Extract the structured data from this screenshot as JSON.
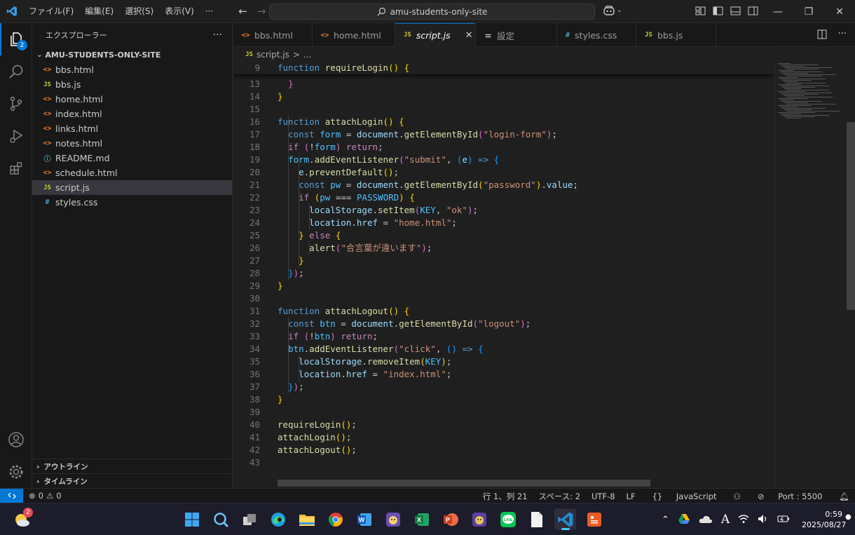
{
  "titlebar": {
    "menu": [
      "ファイル(F)",
      "編集(E)",
      "選択(S)",
      "表示(V)"
    ],
    "more": "···",
    "search_text": "amu-students-only-site"
  },
  "activity": {
    "explorer_badge": "2"
  },
  "sidebar": {
    "title": "エクスプローラー",
    "more": "···",
    "folder": "AMU-STUDENTS-ONLY-SITE",
    "files": [
      {
        "name": "bbs.html",
        "type": "html"
      },
      {
        "name": "bbs.js",
        "type": "js"
      },
      {
        "name": "home.html",
        "type": "html"
      },
      {
        "name": "index.html",
        "type": "html"
      },
      {
        "name": "links.html",
        "type": "html"
      },
      {
        "name": "notes.html",
        "type": "html"
      },
      {
        "name": "README.md",
        "type": "md"
      },
      {
        "name": "schedule.html",
        "type": "html"
      },
      {
        "name": "script.js",
        "type": "js",
        "selected": true
      },
      {
        "name": "styles.css",
        "type": "css"
      }
    ],
    "outline": "アウトライン",
    "timeline": "タイムライン"
  },
  "tabs": [
    {
      "label": "bbs.html",
      "type": "html",
      "state": "normal"
    },
    {
      "label": "home.html",
      "type": "html",
      "state": "dirty"
    },
    {
      "label": "script.js",
      "type": "js",
      "state": "active"
    },
    {
      "label": "設定",
      "type": "settings",
      "state": "normal"
    },
    {
      "label": "styles.css",
      "type": "css",
      "state": "dirty"
    },
    {
      "label": "bbs.js",
      "type": "js",
      "state": "normal"
    }
  ],
  "breadcrumb": {
    "file": "script.js",
    "sep": ">",
    "rest": "..."
  },
  "editor": {
    "sticky_line": {
      "n": "9",
      "html": "<span class='k'>function</span> <span class='f'>requireLogin</span><span class='b1'>()</span> <span class='b1'>{</span>"
    },
    "lines": [
      {
        "n": "13",
        "html": "  <span class='b2'>}</span>"
      },
      {
        "n": "14",
        "html": "<span class='b1'>}</span>"
      },
      {
        "n": "15",
        "html": ""
      },
      {
        "n": "16",
        "html": "<span class='k'>function</span> <span class='f'>attachLogin</span><span class='b1'>()</span> <span class='b1'>{</span>"
      },
      {
        "n": "17",
        "html": "  <span class='k'>const</span> <span class='c'>form</span> = <span class='v'>document</span>.<span class='f'>getElementById</span><span class='b2'>(</span><span class='s'>\"login-form\"</span><span class='b2'>)</span>;"
      },
      {
        "n": "18",
        "html": "  <span class='kc'>if</span> <span class='b2'>(</span>!<span class='c'>form</span><span class='b2'>)</span> <span class='kc'>return</span>;"
      },
      {
        "n": "19",
        "html": "  <span class='c'>form</span>.<span class='f'>addEventListener</span><span class='b2'>(</span><span class='s'>\"submit\"</span>, <span class='b3'>(</span><span class='v'>e</span><span class='b3'>)</span> <span class='k'>=&gt;</span> <span class='b3'>{</span>"
      },
      {
        "n": "20",
        "html": "    <span class='v'>e</span>.<span class='f'>preventDefault</span><span class='b1'>()</span>;"
      },
      {
        "n": "21",
        "html": "    <span class='k'>const</span> <span class='c'>pw</span> = <span class='v'>document</span>.<span class='f'>getElementById</span><span class='b1'>(</span><span class='s'>\"password\"</span><span class='b1'>)</span>.<span class='v'>value</span>;"
      },
      {
        "n": "22",
        "html": "    <span class='kc'>if</span> <span class='b1'>(</span><span class='c'>pw</span> === <span class='c'>PASSWORD</span><span class='b1'>)</span> <span class='b1'>{</span>"
      },
      {
        "n": "23",
        "html": "      <span class='v'>localStorage</span>.<span class='f'>setItem</span><span class='b2'>(</span><span class='c'>KEY</span>, <span class='s'>\"ok\"</span><span class='b2'>)</span>;"
      },
      {
        "n": "24",
        "html": "      <span class='v'>location</span>.<span class='v'>href</span> = <span class='s'>\"home.html\"</span>;"
      },
      {
        "n": "25",
        "html": "    <span class='b1'>}</span> <span class='kc'>else</span> <span class='b1'>{</span>"
      },
      {
        "n": "26",
        "html": "      <span class='f'>alert</span><span class='b2'>(</span><span class='s'>\"合言葉が違います\"</span><span class='b2'>)</span>;"
      },
      {
        "n": "27",
        "html": "    <span class='b1'>}</span>"
      },
      {
        "n": "28",
        "html": "  <span class='b3'>}</span><span class='b2'>)</span>;"
      },
      {
        "n": "29",
        "html": "<span class='b1'>}</span>"
      },
      {
        "n": "30",
        "html": ""
      },
      {
        "n": "31",
        "html": "<span class='k'>function</span> <span class='f'>attachLogout</span><span class='b1'>()</span> <span class='b1'>{</span>"
      },
      {
        "n": "32",
        "html": "  <span class='k'>const</span> <span class='c'>btn</span> = <span class='v'>document</span>.<span class='f'>getElementById</span><span class='b2'>(</span><span class='s'>\"logout\"</span><span class='b2'>)</span>;"
      },
      {
        "n": "33",
        "html": "  <span class='kc'>if</span> <span class='b2'>(</span>!<span class='c'>btn</span><span class='b2'>)</span> <span class='kc'>return</span>;"
      },
      {
        "n": "34",
        "html": "  <span class='c'>btn</span>.<span class='f'>addEventListener</span><span class='b2'>(</span><span class='s'>\"click\"</span>, <span class='b3'>()</span> <span class='k'>=&gt;</span> <span class='b3'>{</span>"
      },
      {
        "n": "35",
        "html": "    <span class='v'>localStorage</span>.<span class='f'>removeItem</span><span class='b1'>(</span><span class='c'>KEY</span><span class='b1'>)</span>;"
      },
      {
        "n": "36",
        "html": "    <span class='v'>location</span>.<span class='v'>href</span> = <span class='s'>\"index.html\"</span>;"
      },
      {
        "n": "37",
        "html": "  <span class='b3'>}</span><span class='b2'>)</span>;"
      },
      {
        "n": "38",
        "html": "<span class='b1'>}</span>"
      },
      {
        "n": "39",
        "html": ""
      },
      {
        "n": "40",
        "html": "<span class='f'>requireLogin</span><span class='b1'>()</span>;"
      },
      {
        "n": "41",
        "html": "<span class='f'>attachLogin</span><span class='b1'>()</span>;"
      },
      {
        "n": "42",
        "html": "<span class='f'>attachLogout</span><span class='b1'>()</span>;"
      },
      {
        "n": "43",
        "html": ""
      }
    ]
  },
  "status": {
    "errors": "0",
    "warnings": "0",
    "position": "行 1、列 21",
    "spaces": "スペース: 2",
    "encoding": "UTF-8",
    "eol": "LF",
    "language": "JavaScript",
    "port": "Port : 5500"
  },
  "taskbar": {
    "weather_badge": "2",
    "time": "0:59",
    "date": "2025/08/27",
    "ime": "A"
  }
}
